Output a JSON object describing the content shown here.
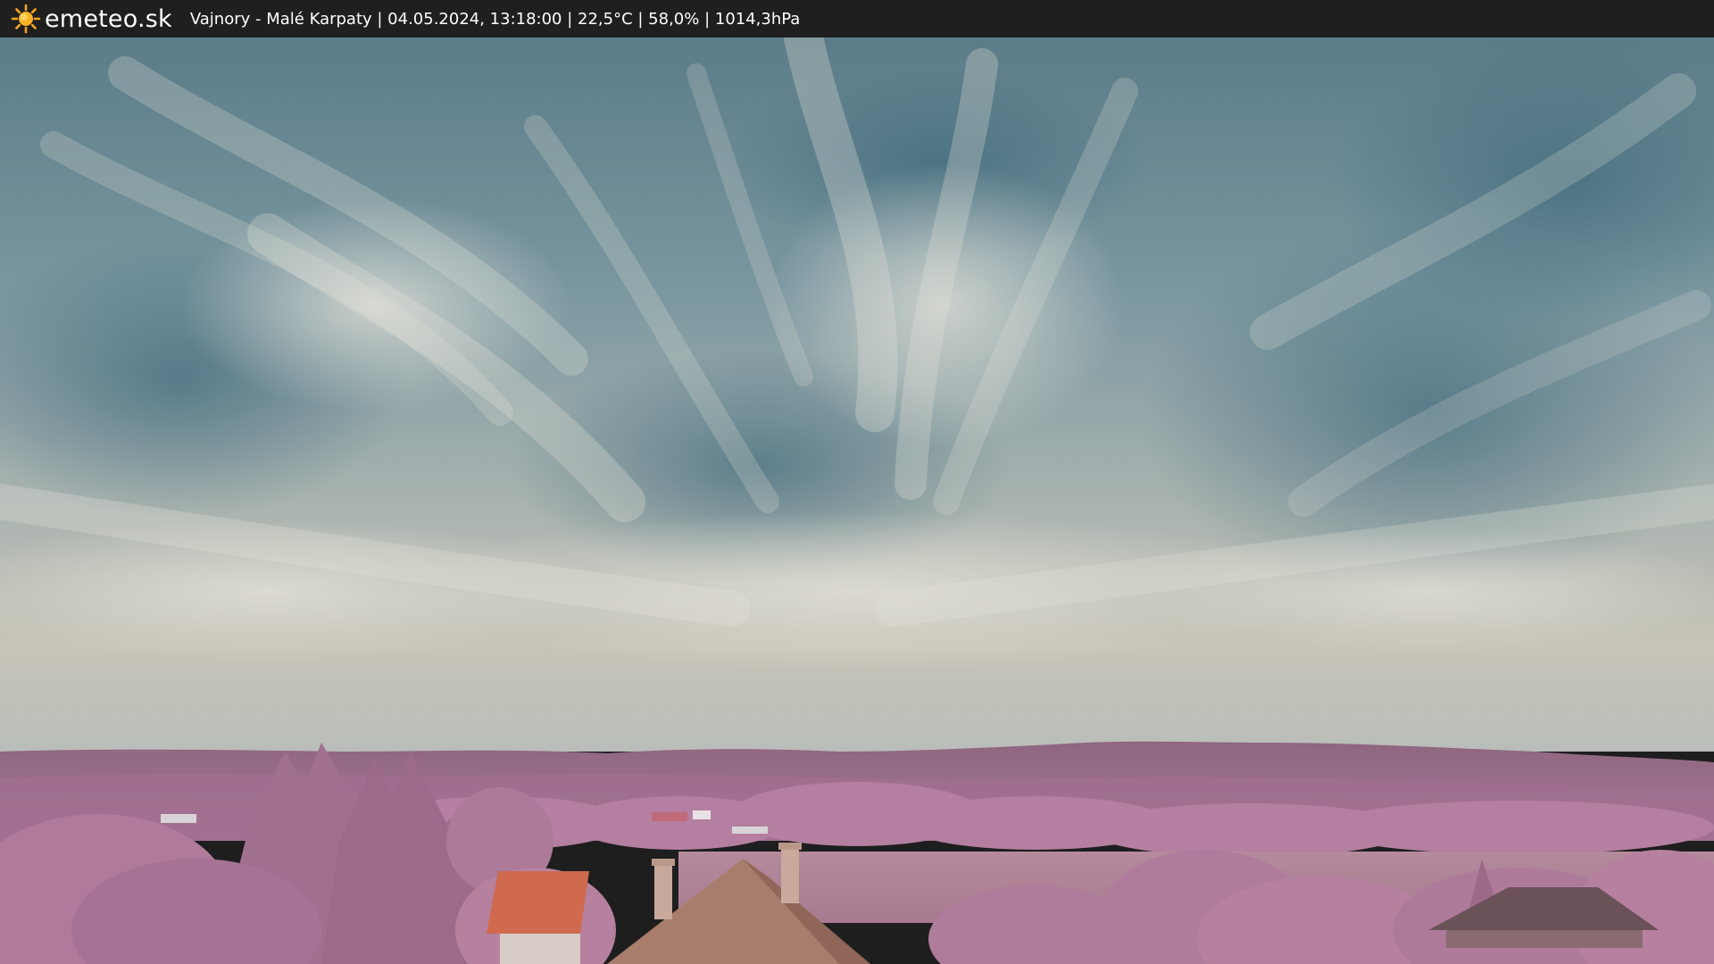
{
  "header": {
    "brand": "emeteo.sk",
    "caption": "Vajnory - Malé Karpaty | 04.05.2024, 13:18:00 | 22,5°C | 58,0% | 1014,3hPa",
    "logo_icon": "sun-icon",
    "bar_color": "#1f1f1f"
  },
  "scene": {
    "sky_top": "#5e7f8a",
    "sky_bottom": "#c4c2b7",
    "hills": "#9a6b88",
    "foliage": "#b57fa2",
    "roof_tile": "#d4644a",
    "roof_brown": "#a87a6c"
  }
}
